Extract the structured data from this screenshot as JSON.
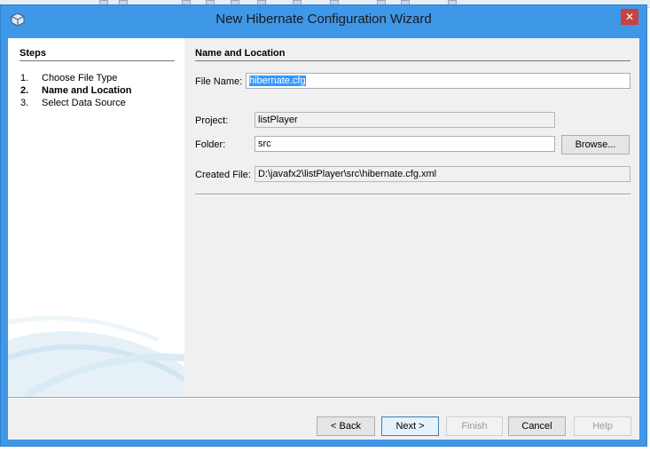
{
  "window": {
    "title": "New Hibernate Configuration Wizard",
    "close_glyph": "✕",
    "app_icon": "cube-icon"
  },
  "steps": {
    "title": "Steps",
    "items": [
      {
        "num": "1.",
        "label": "Choose File Type",
        "current": false
      },
      {
        "num": "2.",
        "label": "Name and Location",
        "current": true
      },
      {
        "num": "3.",
        "label": "Select Data Source",
        "current": false
      }
    ]
  },
  "content": {
    "section_title": "Name and Location",
    "file_name_label": "File Name:",
    "file_name_value": "hibernate.cfg",
    "project_label": "Project:",
    "project_value": "listPlayer",
    "folder_label": "Folder:",
    "folder_value": "src",
    "browse_label": "Browse...",
    "created_file_label": "Created File:",
    "created_file_value": "D:\\javafx2\\listPlayer\\src\\hibernate.cfg.xml"
  },
  "buttons": {
    "back": "< Back",
    "next": "Next >",
    "finish": "Finish",
    "cancel": "Cancel",
    "help": "Help"
  },
  "colors": {
    "titlebar": "#3f97e8",
    "selection": "#3399ff",
    "close": "#c74242"
  }
}
